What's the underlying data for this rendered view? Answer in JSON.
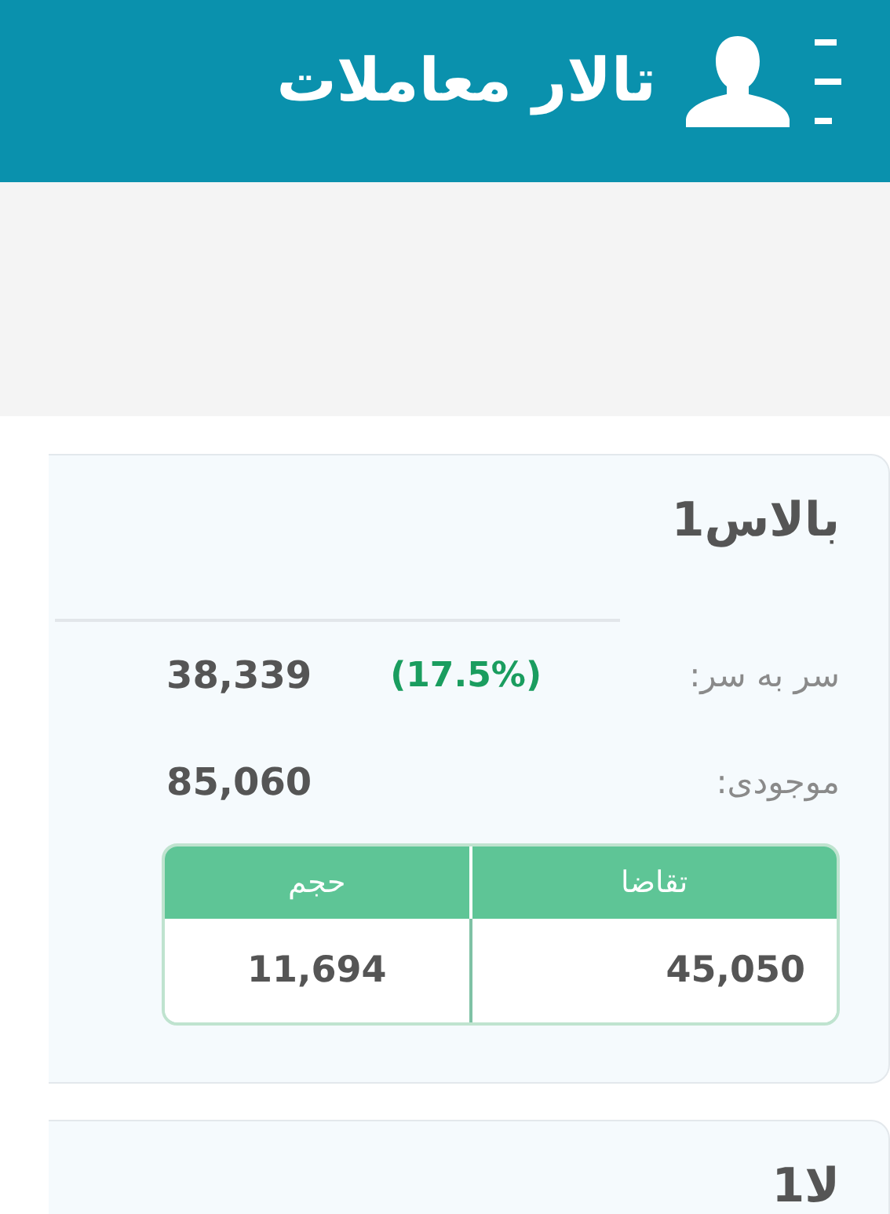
{
  "header": {
    "title": "تالار معاملات"
  },
  "cards": [
    {
      "title": "بالاس1",
      "stats": [
        {
          "label": "سر به سر:",
          "change": "(17.5%)",
          "value": "38,339"
        },
        {
          "label": "موجودی:",
          "value": "85,060"
        }
      ],
      "table": {
        "columns": [
          "تقاضا",
          "حجم"
        ],
        "rows": [
          [
            "45,050",
            "11,694"
          ]
        ]
      }
    },
    {
      "title": "لا1"
    }
  ]
}
